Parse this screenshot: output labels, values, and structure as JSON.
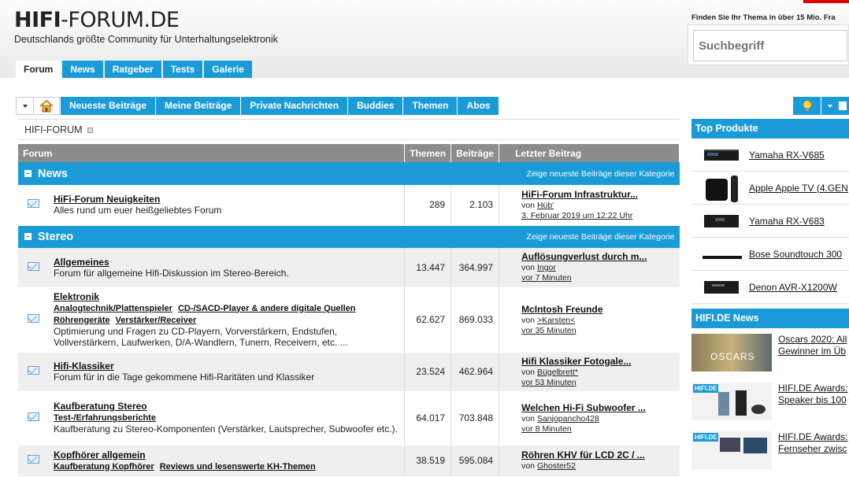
{
  "header": {
    "logo_bold": "HIFI",
    "logo_rest": "-FORUM.DE",
    "tagline": "Deutschlands größte Community für Unterhaltungselektronik",
    "finden_text": "Finden Sie Ihr Thema in über 15 Mio. Fra",
    "search_placeholder": "Suchbegriff",
    "tabs": [
      "Forum",
      "News",
      "Ratgeber",
      "Tests",
      "Galerie"
    ]
  },
  "subnav": [
    "Neueste Beiträge",
    "Meine Beiträge",
    "Private Nachrichten",
    "Buddies",
    "Themen",
    "Abos"
  ],
  "breadcrumb": "HIFI-FORUM",
  "table": {
    "col_forum": "Forum",
    "col_themen": "Themen",
    "col_beitraege": "Beiträge",
    "col_last": "Letzter Beitrag",
    "categories": [
      {
        "name": "News",
        "link": "Zeige neueste Beiträge dieser Kategorie",
        "forums": [
          {
            "title": "HiFi-Forum Neuigkeiten",
            "subs": [],
            "desc": "Alles rund um euer heißgeliebtes Forum",
            "themen": "289",
            "beitraege": "2.103",
            "last_title": "HiFi-Forum Infrastruktur...",
            "von": "von",
            "last_user": "Hüb'",
            "last_time": "3. Februar 2019 um 12:22 Uhr"
          }
        ]
      },
      {
        "name": "Stereo",
        "link": "Zeige neueste Beiträge dieser Kategorie",
        "forums": [
          {
            "title": "Allgemeines",
            "subs": [],
            "desc": "Forum für allgemeine Hifi-Diskussion im Stereo-Bereich.",
            "themen": "13.447",
            "beitraege": "364.997",
            "last_title": "Auflösungverlust durch m...",
            "von": "von",
            "last_user": "Ingor",
            "last_time": "vor 7 Minuten"
          },
          {
            "title": "Elektronik",
            "subs": [
              "Analogtechnik/Plattenspieler",
              "CD-/SACD-Player & andere digitale Quellen",
              "Röhrengeräte",
              "Verstärker/Receiver"
            ],
            "desc": "Optimierung und Fragen zu CD-Playern, Vorverstärkern, Endstufen, Vollverstärkern, Laufwerken, D/A-Wandlern, Tunern, Receivern, etc. ...",
            "themen": "62.627",
            "beitraege": "869.033",
            "last_title": "McIntosh Freunde",
            "von": "von",
            "last_user": ">Karsten<",
            "last_time": "vor 35 Minuten"
          },
          {
            "title": "Hifi-Klassiker",
            "subs": [],
            "desc": "Forum für in die Tage gekommene Hifi-Raritäten und Klassiker",
            "themen": "23.524",
            "beitraege": "462.964",
            "last_title": "Hifi Klassiker Fotogale...",
            "von": "von",
            "last_user": "Bügelbrett*",
            "last_time": "vor 53 Minuten"
          },
          {
            "title": "Kaufberatung Stereo",
            "subs": [
              "Test-/Erfahrungsberichte"
            ],
            "desc": "Kaufberatung zu Stereo-Komponenten (Verstärker, Lautsprecher, Subwoofer etc.).",
            "themen": "64.017",
            "beitraege": "703.848",
            "last_title": "Welchen Hi-Fi Subwoofer ...",
            "von": "von",
            "last_user": "Sanjopancho428",
            "last_time": "vor 8 Minuten"
          },
          {
            "title": "Kopfhörer allgemein",
            "subs": [
              "Kaufberatung Kopfhörer",
              "Reviews und lesenswerte KH-Themen"
            ],
            "desc": "",
            "themen": "38.519",
            "beitraege": "595.084",
            "last_title": "Röhren KHV für LCD 2C / ...",
            "von": "von",
            "last_user": "Ghoster52",
            "last_time": ""
          }
        ]
      }
    ]
  },
  "sidebar": {
    "top_title": "Top Produkte",
    "products": [
      "Yamaha RX-V685",
      "Apple Apple TV (4.GEN",
      "Yamaha RX-V683",
      "Bose Soundtouch 300",
      "Denon AVR-X1200W"
    ],
    "news_title": "HIFI.DE News",
    "news": [
      {
        "line1": "Oscars 2020: All",
        "line2": "Gewinner im Üb"
      },
      {
        "line1": "HIFI.DE Awards:",
        "line2": "Speaker bis 100"
      },
      {
        "line1": "HIFI.DE Awards:",
        "line2": "Fernseher zwisc"
      }
    ],
    "news_img_text": [
      "OSCARS",
      "HIFI.DE",
      "HIFI.DE"
    ]
  },
  "colors": {
    "accent": "#1a9bd7",
    "header_gray": "#8c8c8c",
    "brand_red": "#e10000"
  }
}
